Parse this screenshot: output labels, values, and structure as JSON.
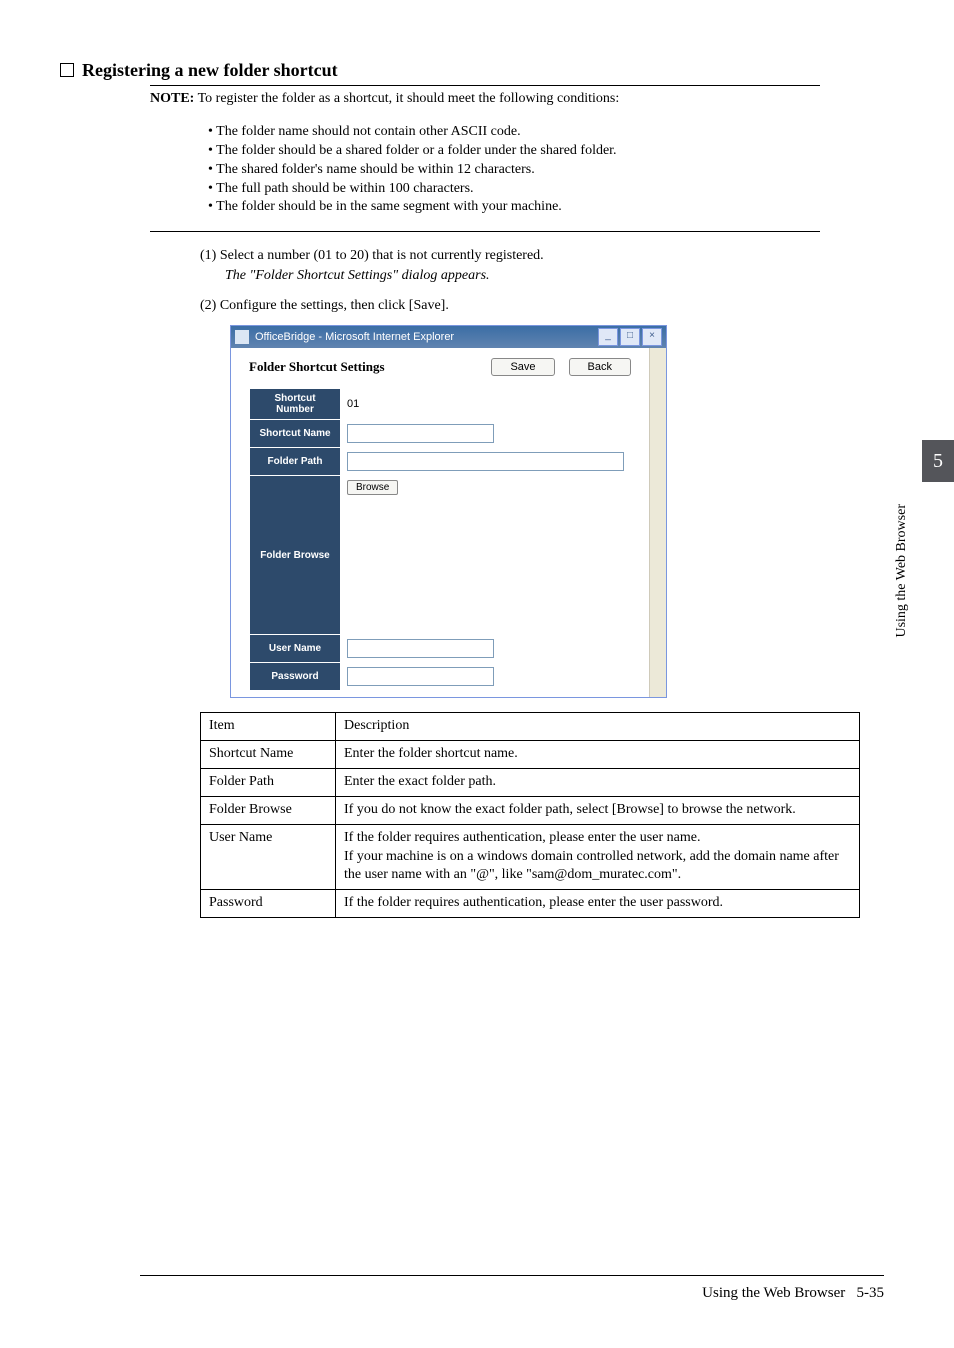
{
  "heading": "Registering a new folder shortcut",
  "note_label": "NOTE:",
  "note_intro": "To register the folder as a shortcut, it should meet the following conditions:",
  "note_bullets": [
    "The folder name should not contain other ASCII code.",
    "The folder should be a shared folder or a folder under the shared folder.",
    "The shared folder's name should be within 12 characters.",
    "The full path should be within 100 characters.",
    "The folder should be in the same segment with your machine."
  ],
  "step1_lead": "(1) Select a number (01 to 20) that is not currently registered.",
  "step1_result": "The \"Folder Shortcut Settings\" dialog appears.",
  "step2": "(2) Configure the settings, then click [Save].",
  "ie": {
    "title": "OfficeBridge - Microsoft Internet Explorer",
    "panel_title": "Folder Shortcut Settings",
    "save": "Save",
    "back": "Back",
    "rows": {
      "shortcut_number_label": "Shortcut Number",
      "shortcut_number_value": "01",
      "shortcut_name_label": "Shortcut Name",
      "folder_path_label": "Folder Path",
      "folder_browse_label": "Folder Browse",
      "browse_btn": "Browse",
      "user_name_label": "User Name",
      "password_label": "Password"
    }
  },
  "table": {
    "header_item": "Item",
    "header_desc": "Description",
    "rows": [
      {
        "item": "Shortcut Name",
        "desc": "Enter the folder shortcut name."
      },
      {
        "item": "Folder Path",
        "desc": "Enter the exact folder path."
      },
      {
        "item": "Folder Browse",
        "desc": "If you do not know the exact folder path, select [Browse] to browse the network."
      },
      {
        "item": "User Name",
        "desc": "If the folder requires authentication, please enter the user name.\nIf your machine is on a windows domain controlled network, add the domain name after the user name with an \"@\", like \"sam@dom_muratec.com\"."
      },
      {
        "item": "Password",
        "desc": "If the folder requires authentication, please enter the user password."
      }
    ]
  },
  "side": {
    "chapter": "5",
    "caption": "Using the Web Browser"
  },
  "footer": {
    "text": "Using the Web Browser",
    "page": "5-35"
  }
}
